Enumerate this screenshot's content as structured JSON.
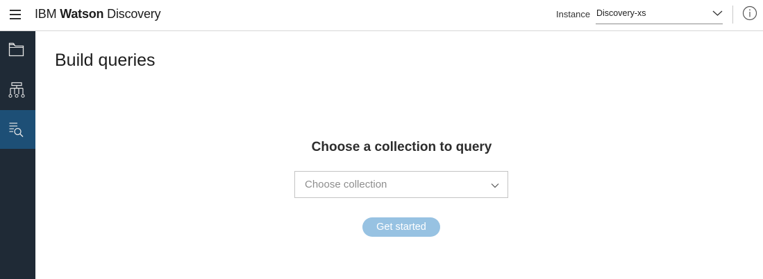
{
  "header": {
    "brand_ibm": "IBM",
    "brand_watson": "Watson",
    "brand_product": "Discovery",
    "instance_label": "Instance",
    "instance_value": "Discovery-xs"
  },
  "icons": {
    "menu": "hamburger-menu-icon",
    "instance_dropdown": "chevron-down-icon",
    "info": "info-icon",
    "sidebar_manage": "folder-icon",
    "sidebar_build": "hierarchy-icon",
    "sidebar_query": "query-search-icon",
    "collection_dropdown": "chevron-down-icon"
  },
  "sidebar": {
    "active_index": 2,
    "active_color": "#1d4f76",
    "background": "#1f2a36"
  },
  "main": {
    "title": "Build queries",
    "heading": "Choose a collection to query",
    "collection_placeholder": "Choose collection",
    "get_started_label": "Get started",
    "button_color": "#97c2e2"
  }
}
